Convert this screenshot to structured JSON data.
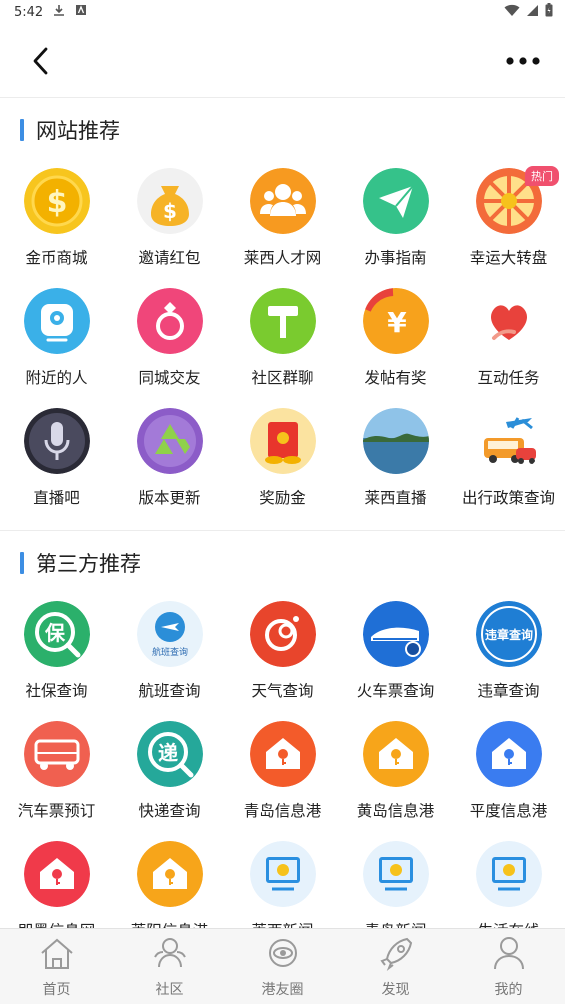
{
  "status_bar": {
    "time": "5:42"
  },
  "section1": {
    "title": "网站推荐",
    "items": [
      {
        "label": "金币商城",
        "icon": "gold-coin-icon",
        "color": "#f5b800"
      },
      {
        "label": "邀请红包",
        "icon": "money-bag-icon",
        "color": "#f7b52c"
      },
      {
        "label": "莱西人才网",
        "icon": "people-group-icon",
        "color": "#f79a20"
      },
      {
        "label": "办事指南",
        "icon": "paper-plane-icon",
        "color": "#35c28a"
      },
      {
        "label": "幸运大转盘",
        "icon": "prize-wheel-icon",
        "color": "#f15a4a",
        "badge": "热门"
      },
      {
        "label": "附近的人",
        "icon": "location-pin-icon",
        "color": "#3ab0e8"
      },
      {
        "label": "同城交友",
        "icon": "ring-icon",
        "color": "#f0467a"
      },
      {
        "label": "社区群聊",
        "icon": "paint-roller-icon",
        "color": "#7acb2f"
      },
      {
        "label": "发帖有奖",
        "icon": "yen-reward-icon",
        "color": "#f7a21c"
      },
      {
        "label": "互动任务",
        "icon": "heart-hand-icon",
        "color": "#e8423c"
      },
      {
        "label": "直播吧",
        "icon": "microphone-icon",
        "color": "#3a3a4a"
      },
      {
        "label": "版本更新",
        "icon": "recycle-icon",
        "color": "#8c5cc8"
      },
      {
        "label": "奖励金",
        "icon": "red-envelope-icon",
        "color": "#f2c23a"
      },
      {
        "label": "莱西直播",
        "icon": "lake-scenery-icon",
        "color": "#5aa0c8"
      },
      {
        "label": "出行政策查询",
        "icon": "travel-bus-plane-icon",
        "color": "#f39a2a"
      }
    ]
  },
  "section2": {
    "title": "第三方推荐",
    "items": [
      {
        "label": "社保查询",
        "icon": "social-security-icon",
        "color": "#2bb06b",
        "glyph": "保"
      },
      {
        "label": "航班查询",
        "icon": "flight-icon",
        "color": "#2b8ed8",
        "glyph": "航班查询"
      },
      {
        "label": "天气查询",
        "icon": "weather-icon",
        "color": "#e8452c"
      },
      {
        "label": "火车票查询",
        "icon": "train-icon",
        "color": "#1f6fd6"
      },
      {
        "label": "违章查询",
        "icon": "violation-icon",
        "color": "#1f7ed4",
        "glyph": "违章查询"
      },
      {
        "label": "汽车票预订",
        "icon": "bus-icon",
        "color": "#f06050"
      },
      {
        "label": "快递查询",
        "icon": "express-icon",
        "color": "#25a89a",
        "glyph": "递"
      },
      {
        "label": "青岛信息港",
        "icon": "house-info-icon",
        "color": "#f35b2a"
      },
      {
        "label": "黄岛信息港",
        "icon": "house-info-icon",
        "color": "#f7a51a"
      },
      {
        "label": "平度信息港",
        "icon": "house-info-icon",
        "color": "#3a7cf0"
      },
      {
        "label": "即墨信息网",
        "icon": "house-info-icon",
        "color": "#f03a4a"
      },
      {
        "label": "莱阳信息港",
        "icon": "house-info-icon",
        "color": "#f7a51a"
      },
      {
        "label": "莱西新闻",
        "icon": "news-monitor-icon",
        "color": "#2a8fe0"
      },
      {
        "label": "青岛新闻",
        "icon": "news-monitor-icon",
        "color": "#2a8fe0"
      },
      {
        "label": "生活在线",
        "icon": "news-monitor-icon",
        "color": "#2a8fe0"
      }
    ]
  },
  "bottom_nav": [
    {
      "label": "首页",
      "icon": "home-icon"
    },
    {
      "label": "社区",
      "icon": "community-icon"
    },
    {
      "label": "港友圈",
      "icon": "planet-icon"
    },
    {
      "label": "发现",
      "icon": "rocket-icon"
    },
    {
      "label": "我的",
      "icon": "profile-icon"
    }
  ]
}
